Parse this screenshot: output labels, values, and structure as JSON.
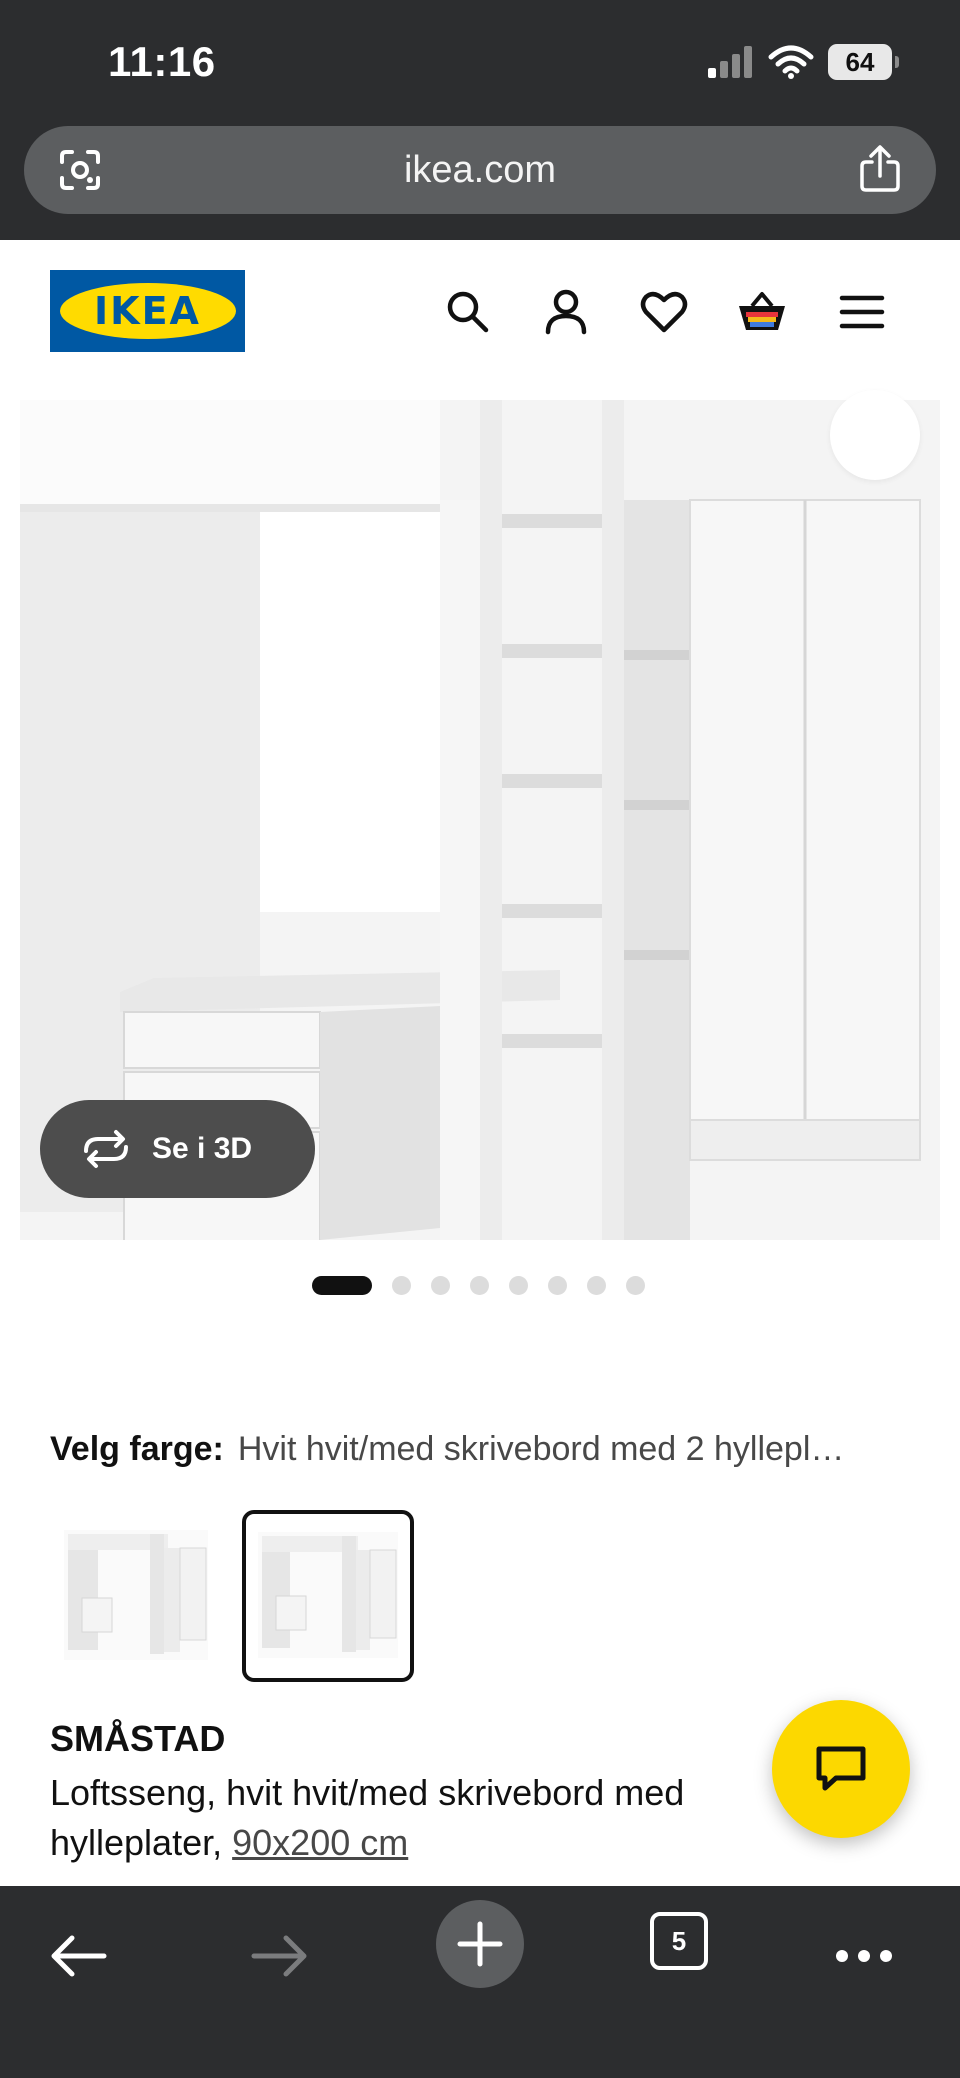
{
  "status_bar": {
    "time": "11:16",
    "battery": "64"
  },
  "browser": {
    "url": "ikea.com",
    "open_tabs": "5"
  },
  "header": {
    "logo_text": "IKEA",
    "icons": [
      "search-icon",
      "account-icon",
      "heart-icon",
      "basket-icon",
      "menu-icon"
    ]
  },
  "gallery": {
    "view_3d_label": "Se i 3D",
    "image_count": 8,
    "active_index": 0
  },
  "color_picker": {
    "label": "Velg farge:",
    "value": "Hvit hvit/med skrivebord med 2 hyllepl…",
    "swatch_count": 2,
    "selected_index": 1
  },
  "product": {
    "name": "SMÅSTAD",
    "description": "Loftsseng, hvit hvit/med skrivebord med",
    "description_line2": "hylleplater,",
    "size_link": "90x200 cm"
  },
  "colors": {
    "ikea_blue": "#0058a3",
    "ikea_yellow": "#ffdb00",
    "chat_yellow": "#fcd800",
    "chrome_dark": "#2c2d2f"
  }
}
